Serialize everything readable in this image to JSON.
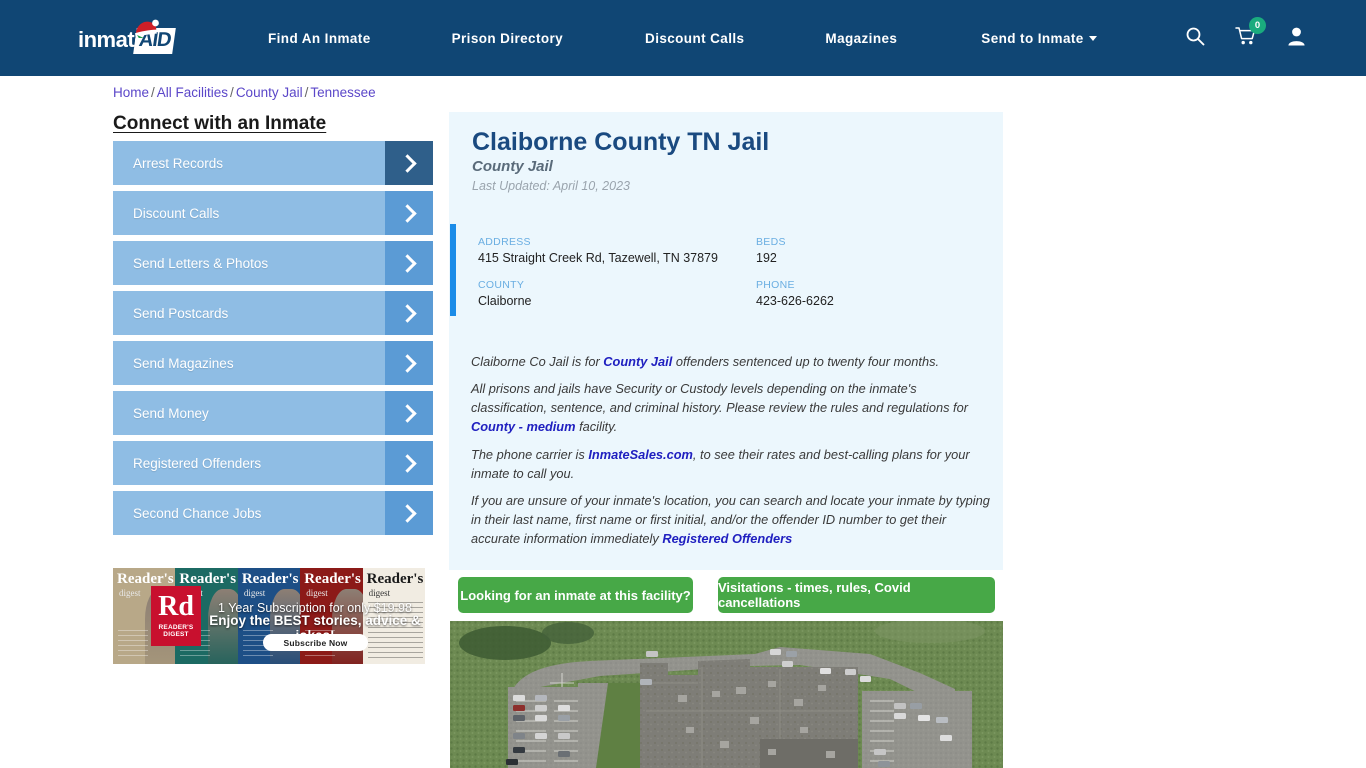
{
  "header": {
    "logo_text": "inmate",
    "logo_accent": "AID",
    "logo_icon": "santa-hat-icon",
    "nav": [
      {
        "label": "Find An Inmate"
      },
      {
        "label": "Prison Directory"
      },
      {
        "label": "Discount Calls"
      },
      {
        "label": "Magazines"
      },
      {
        "label": "Send to Inmate"
      }
    ],
    "icons": {
      "search": "search-icon",
      "cart": "shopping-cart-icon",
      "account": "user-account-icon"
    },
    "cart_count": "0",
    "bg_color": "#104674"
  },
  "breadcrumb": {
    "items": [
      "Home",
      "All Facilities",
      "County Jail",
      "Tennessee"
    ],
    "separator": "/"
  },
  "sidebar": {
    "title": "Connect with an Inmate",
    "items": [
      {
        "label": "Arrest Records",
        "active": true
      },
      {
        "label": "Discount Calls",
        "active": false
      },
      {
        "label": "Send Letters & Photos",
        "active": false
      },
      {
        "label": "Send Postcards",
        "active": false
      },
      {
        "label": "Send Magazines",
        "active": false
      },
      {
        "label": "Send Money",
        "active": false
      },
      {
        "label": "Registered Offenders",
        "active": false
      },
      {
        "label": "Second Chance Jobs",
        "active": false
      }
    ]
  },
  "ad": {
    "brand": "Rd",
    "brand_sub": "READER'S DIGEST",
    "cover_title": "Reader's",
    "cover_sub": "digest",
    "line1": "1 Year Subscription for only $19.98",
    "line2": "Enjoy the BEST stories, advice & jokes!",
    "cta": "Subscribe Now"
  },
  "facility": {
    "name": "Claiborne County TN Jail",
    "type": "County Jail",
    "last_updated": "Last Updated: April 10, 2023",
    "info": [
      {
        "label": "ADDRESS",
        "value": "415 Straight Creek Rd, Tazewell, TN 37879"
      },
      {
        "label": "BEDS",
        "value": "192"
      },
      {
        "label": "COUNTY",
        "value": "Claiborne"
      },
      {
        "label": "PHONE",
        "value": "423-626-6262"
      }
    ],
    "paragraphs": {
      "p1_a": "Claiborne Co Jail is for ",
      "p1_link": "County Jail",
      "p1_b": " offenders sentenced up to twenty four months.",
      "p2_a": "All prisons and jails have Security or Custody levels depending on the inmate's classification, sentence, and criminal history. Please review the rules and regulations for ",
      "p2_link": "County - medium",
      "p2_b": " facility.",
      "p3_a": "The phone carrier is ",
      "p3_link": "InmateSales.com",
      "p3_b": ", to see their rates and best-calling plans for your inmate to call you.",
      "p4_a": "If you are unsure of your inmate's location, you can search and locate your inmate by typing in their last name, first name or first initial, and/or the offender ID number to get their accurate information immediately ",
      "p4_link": "Registered Offenders"
    }
  },
  "actions": {
    "find_inmate": "Looking for an inmate at this facility?",
    "visitations": "Visitations - times, rules, Covid cancellations"
  },
  "satellite": {
    "alt": "aerial-satellite-view-of-jail-facility"
  },
  "colors": {
    "header_bg": "#104674",
    "panel_bg": "#ecf7fd",
    "accent_blue": "#1b8ce8",
    "sidebar_btn": "#8fbde4",
    "sidebar_arrow": "#5b9bd5",
    "sidebar_arrow_active": "#2f5f8a",
    "green_button": "#47a847",
    "link": "#2020c0",
    "breadcrumb_link": "#5b47c9",
    "title": "#1a4a80",
    "badge_green": "#1aab7e"
  }
}
